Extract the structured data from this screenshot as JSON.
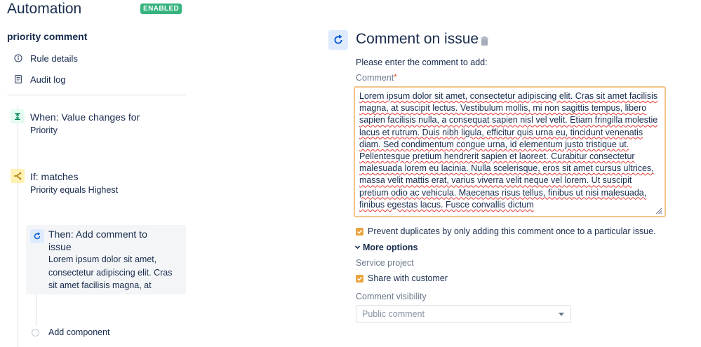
{
  "header": {
    "title": "Automation",
    "status_badge": "ENABLED"
  },
  "rule": {
    "name": "priority comment"
  },
  "nav": [
    {
      "label": "Rule details",
      "icon": "info-icon"
    },
    {
      "label": "Audit log",
      "icon": "document-icon"
    }
  ],
  "steps": {
    "trigger": {
      "title": "When: Value changes for",
      "description": "Priority",
      "icon": "trigger-icon",
      "color": "#e3fcef"
    },
    "condition": {
      "title": "If: matches",
      "description": "Priority equals Highest",
      "icon": "branch-condition-icon",
      "color": "#fff0b3"
    },
    "action": {
      "title_line1": "Then: Add comment to",
      "title_line2": "issue",
      "description_lines": [
        "Lorem ipsum dolor sit amet,",
        "consectetur adipiscing elit. Cras",
        "sit amet facilisis magna, at"
      ],
      "icon": "comment-action-icon",
      "color": "#deebff"
    },
    "add_component": "Add component"
  },
  "editor": {
    "title": "Comment on issue",
    "instruction": "Please enter the comment to add:",
    "comment_label": "Comment",
    "required_mark": "*",
    "comment_text": "Lorem ipsum dolor sit amet, consectetur adipiscing elit. Cras sit amet facilisis magna, at suscipit lectus. Vestibulum mollis, mi non sagittis tempus, libero sapien facilisis nulla, a consequat sapien nisl vel velit. Etiam fringilla molestie lacus et rutrum. Duis nibh ligula, efficitur quis urna eu, tincidunt venenatis diam. Sed condimentum congue urna, id elementum justo tristique ut. Pellentesque pretium hendrerit sapien et laoreet. Curabitur consectetur malesuada lorem eu lacinia. Nulla scelerisque, eros sit amet cursus ultrices, massa velit mattis erat, varius viverra velit neque vel lorem. Ut suscipit pretium odio ac vehicula. Maecenas risus tellus, finibus ut nisi malesuada, finibus egestas lacus. Fusce convallis dictum",
    "prevent_duplicates": {
      "label": "Prevent duplicates by only adding this comment once to a particular issue.",
      "checked": true
    },
    "more_options": "More options",
    "service_project_label": "Service project",
    "share_with_customer": {
      "label": "Share with customer",
      "checked": true
    },
    "visibility_label": "Comment visibility",
    "visibility_value": "Public comment"
  },
  "colors": {
    "accent_checkbox": "#e8a33d",
    "focus_border": "#f4c48a",
    "badge_green": "#36b37e"
  }
}
